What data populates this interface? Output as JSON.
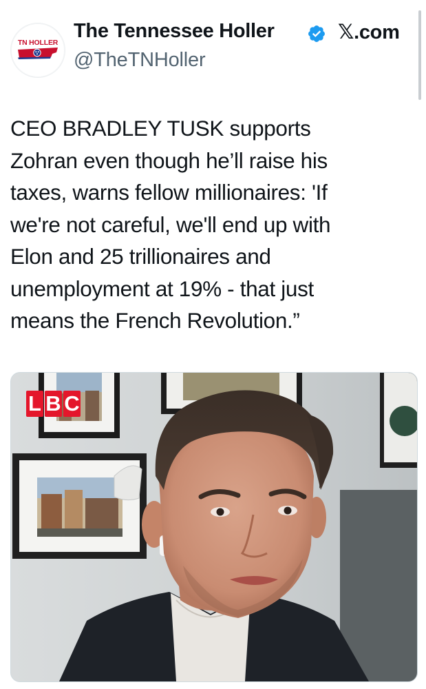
{
  "account": {
    "display_name": "The Tennessee Holler",
    "handle": "@TheTNHoller",
    "verified": true,
    "avatar_text": "TN HOLLER",
    "source_site": "𝕏.com"
  },
  "tweet": {
    "text": "CEO BRADLEY TUSK supports\nZohran even though he’ll raise his\ntaxes, warns fellow millionaires: 'If\nwe're not careful, we'll end up with\nElon and 25 trillionaires and\nunemployment at 19% - that just\nmeans the French Revolution.”"
  },
  "media": {
    "type": "video-still",
    "broadcaster_logo": [
      "L",
      "B",
      "C"
    ]
  },
  "colors": {
    "verified_blue": "#1d9bf0",
    "handle_gray": "#536471",
    "text": "#0f1419",
    "lbc_red": "#e4162b",
    "tn_red": "#c8102e",
    "tn_blue": "#1f3b8f"
  },
  "icons": {
    "verified": "verified-badge-icon",
    "avatar": "tennessee-flag-icon"
  }
}
